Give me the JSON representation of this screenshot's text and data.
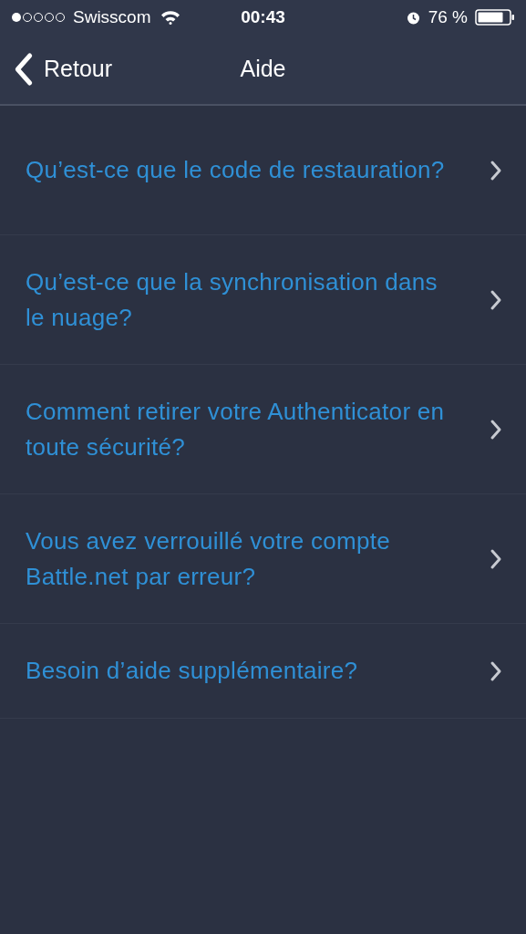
{
  "status_bar": {
    "carrier": "Swisscom",
    "time": "00:43",
    "battery": "76 %"
  },
  "nav": {
    "back": "Retour",
    "title": "Aide"
  },
  "items": [
    {
      "label": "Qu’est-ce que le code de restauration?"
    },
    {
      "label": "Qu’est-ce que la synchronisation dans le nuage?"
    },
    {
      "label": "Comment retirer votre Authenticator en toute sécurité?"
    },
    {
      "label": "Vous avez verrouillé votre compte Battle.net par erreur?"
    },
    {
      "label": "Besoin d’aide supplémentaire?"
    }
  ]
}
